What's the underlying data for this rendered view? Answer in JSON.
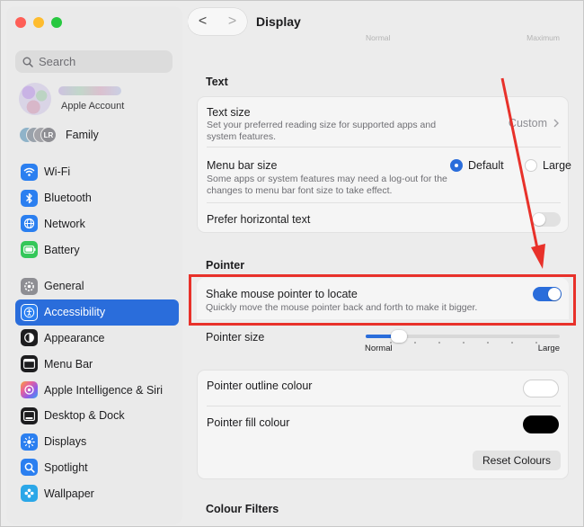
{
  "window": {
    "traffic_lights": [
      "#fe5f57",
      "#febc2e",
      "#28c840"
    ]
  },
  "sidebar": {
    "search_placeholder": "Search",
    "account_label": "Apple Account",
    "family": {
      "label": "Family",
      "avatars": [
        "",
        "",
        "",
        "LR"
      ]
    },
    "groups": [
      [
        {
          "label": "Wi-Fi",
          "icon": "wifi-icon",
          "color": "#2b7ff0"
        },
        {
          "label": "Bluetooth",
          "icon": "bluetooth-icon",
          "color": "#2b7ff0"
        },
        {
          "label": "Network",
          "icon": "globe-icon",
          "color": "#2b7ff0"
        },
        {
          "label": "Battery",
          "icon": "battery-icon",
          "color": "#34c759"
        }
      ],
      [
        {
          "label": "General",
          "icon": "gear-icon",
          "color": "#8e8e93"
        },
        {
          "label": "Accessibility",
          "icon": "accessibility-icon",
          "color": "#2b7ff0",
          "selected": true
        },
        {
          "label": "Appearance",
          "icon": "appearance-icon",
          "color": "#1d1d1f"
        },
        {
          "label": "Menu Bar",
          "icon": "menu-bar-icon",
          "color": "#1d1d1f"
        },
        {
          "label": "Apple Intelligence & Siri",
          "icon": "siri-icon",
          "color": "#e9609b"
        },
        {
          "label": "Desktop & Dock",
          "icon": "dock-icon",
          "color": "#1d1d1f"
        },
        {
          "label": "Displays",
          "icon": "display-sun-icon",
          "color": "#2b7ff0"
        },
        {
          "label": "Spotlight",
          "icon": "spotlight-icon",
          "color": "#2b7ff0"
        },
        {
          "label": "Wallpaper",
          "icon": "wallpaper-icon",
          "color": "#2ba7e8"
        }
      ]
    ]
  },
  "header": {
    "back": "<",
    "forward": ">",
    "title": "Display",
    "ghost_left": "Normal",
    "ghost_right": "Maximum"
  },
  "text_section": {
    "title": "Text",
    "text_size": {
      "label": "Text size",
      "desc": "Set your preferred reading size for supported apps and system features.",
      "value": "Custom"
    },
    "menu_bar_size": {
      "label": "Menu bar size",
      "desc": "Some apps or system features may need a log-out for the changes to menu bar font size to take effect.",
      "options": [
        "Default",
        "Large"
      ],
      "selected": "Default"
    },
    "horizontal_text": {
      "label": "Prefer horizontal text",
      "enabled": false
    }
  },
  "pointer_section": {
    "title": "Pointer",
    "shake": {
      "label": "Shake mouse pointer to locate",
      "desc": "Quickly move the mouse pointer back and forth to make it bigger.",
      "enabled": true
    },
    "pointer_size": {
      "label": "Pointer size",
      "min_label": "Normal",
      "max_label": "Large",
      "value_fraction": 0.17
    },
    "outline_colour": {
      "label": "Pointer outline colour",
      "color": "#ffffff"
    },
    "fill_colour": {
      "label": "Pointer fill colour",
      "color": "#000000"
    },
    "reset_button": "Reset Colours"
  },
  "colour_filters": {
    "title": "Colour Filters"
  },
  "annotation": {
    "color": "#e8312a"
  }
}
